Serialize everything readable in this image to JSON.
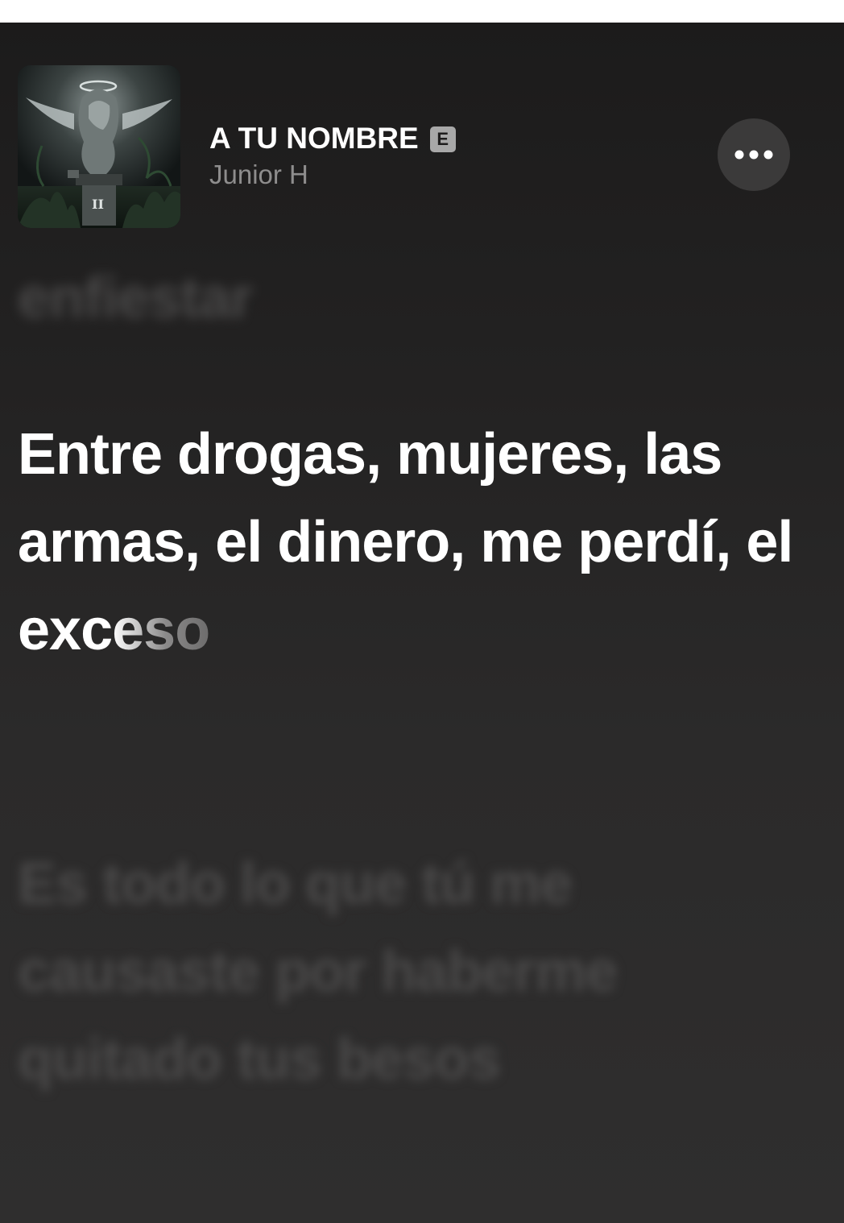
{
  "track": {
    "title": "A TU NOMBRE",
    "explicit_badge": "E",
    "artist": "Junior H"
  },
  "actions": {
    "more_icon": "ellipsis-icon"
  },
  "lyrics": {
    "previous": "enfiestar",
    "current_sung": "Entre drogas, mujeres, las armas, el dinero, me perdí, el exc",
    "current_unsung": "eso",
    "next": "Es todo lo que tú me causaste por haberme quitado tus besos"
  },
  "colors": {
    "background": "#232222",
    "active_lyric": "#ffffff",
    "inactive_lyric": "#4a4949",
    "artist_text": "#8e8d8d",
    "more_button_bg": "#3b3a3a"
  }
}
